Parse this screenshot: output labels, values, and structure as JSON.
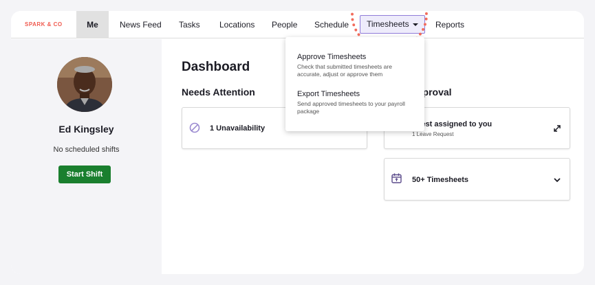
{
  "brand": "SPARK & CO",
  "nav": {
    "items": [
      "Me",
      "News Feed",
      "Tasks",
      "Locations",
      "People",
      "Schedule",
      "Timesheets",
      "Reports"
    ]
  },
  "profile": {
    "name": "Ed Kingsley",
    "shifts_text": "No scheduled shifts",
    "start_button": "Start Shift"
  },
  "dashboard": {
    "title": "Dashboard",
    "needs_attention": {
      "title": "Needs Attention",
      "card_label": "1 Unavailability"
    },
    "approval": {
      "title_visible": "pproval",
      "request_card": {
        "title": "quest assigned to you",
        "subtitle": "1 Leave Request"
      },
      "timesheets_card": {
        "title": "50+ Timesheets"
      }
    }
  },
  "dropdown": {
    "items": [
      {
        "title": "Approve Timesheets",
        "desc": "Check that submitted timesheets are accurate, adjust or approve them"
      },
      {
        "title": "Export Timesheets",
        "desc": "Send approved timesheets to your payroll package"
      }
    ]
  },
  "colors": {
    "brand": "#f05a4f",
    "start_button": "#1a7f2e",
    "highlight_ring": "#f26c5c",
    "active_nav_border": "#8f7bd9",
    "icon_purple": "#9b8ad0"
  }
}
